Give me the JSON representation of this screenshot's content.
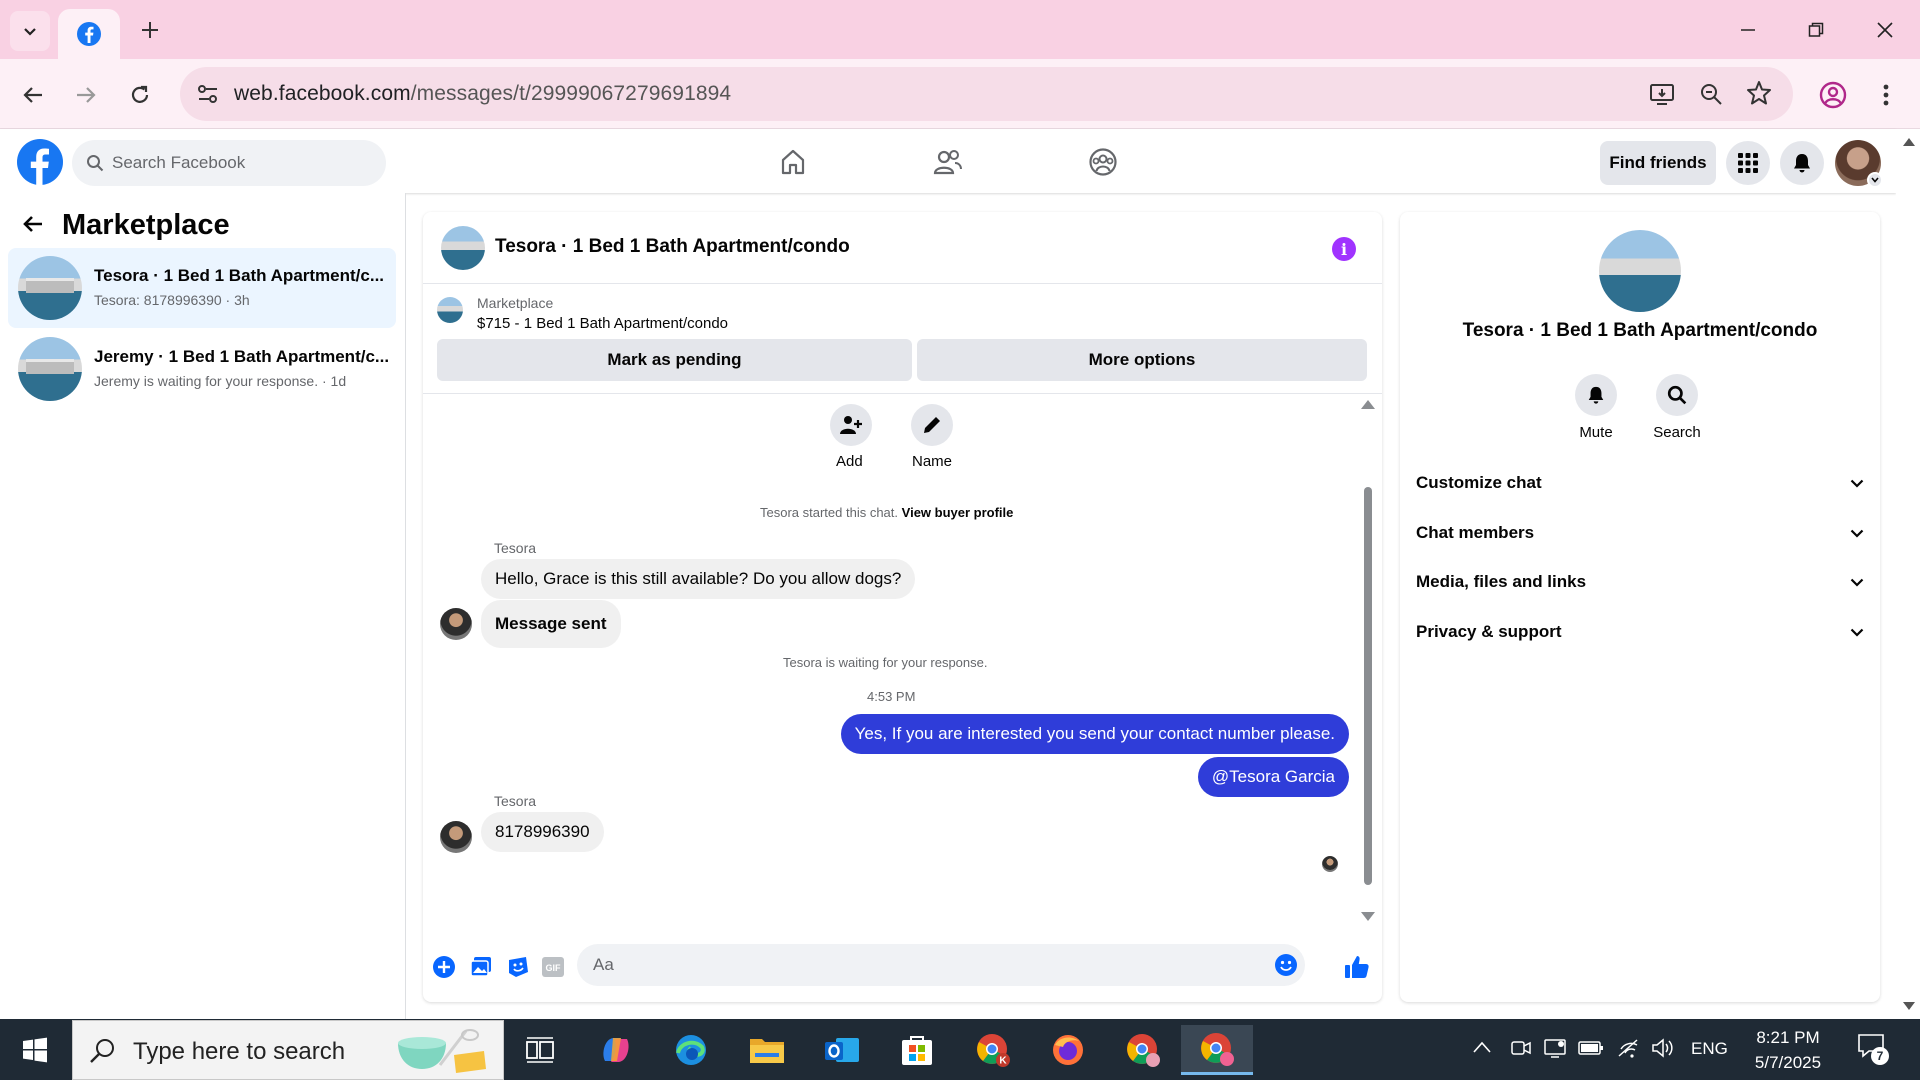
{
  "browser": {
    "url_host": "web.facebook.com",
    "url_path": "/messages/t/29999067279691894",
    "colors": {
      "tabstrip": "#f9d1e3",
      "toolbar": "#fdf0f6"
    }
  },
  "facebook": {
    "search_placeholder": "Search Facebook",
    "find_friends": "Find friends",
    "brand_color": "#1877f2"
  },
  "sidebar": {
    "title": "Marketplace",
    "conversations": [
      {
        "title": "Tesora · 1 Bed 1 Bath Apartment/c...",
        "subtitle": "Tesora: 8178996390 · 3h",
        "active": true
      },
      {
        "title": "Jeremy · 1 Bed 1 Bath Apartment/c...",
        "subtitle": "Jeremy is waiting for your response. · 1d",
        "active": false
      }
    ]
  },
  "chat": {
    "title": "Tesora · 1 Bed 1 Bath Apartment/condo",
    "listing_label": "Marketplace",
    "listing_price": "$715 - 1 Bed 1 Bath Apartment/condo",
    "mark_pending": "Mark as pending",
    "more_options": "More options",
    "add_label": "Add",
    "name_label": "Name",
    "started_text": "Tesora started this chat.",
    "view_buyer_profile": "View buyer profile",
    "sender_1": "Tesora",
    "msg_in_1": "Hello, Grace is this still available? Do you allow dogs?",
    "msg_in_2": "Message sent",
    "waiting_text": "Tesora is waiting for your response.",
    "timestamp": "4:53 PM",
    "msg_out_1": "Yes, If you  are interested you send your  contact number please.",
    "msg_out_2": "@Tesora Garcia",
    "sender_2": "Tesora",
    "msg_in_3": "8178996390",
    "composer_placeholder": "Aa",
    "outgoing_color": "#2f3dd9"
  },
  "info_panel": {
    "title": "Tesora · 1 Bed 1 Bath Apartment/condo",
    "mute": "Mute",
    "search": "Search",
    "sections": [
      "Customize chat",
      "Chat members",
      "Media, files and links",
      "Privacy & support"
    ]
  },
  "taskbar": {
    "search_placeholder": "Type here to search",
    "language": "ENG",
    "time": "8:21 PM",
    "date": "5/7/2025",
    "notifications": "7"
  }
}
